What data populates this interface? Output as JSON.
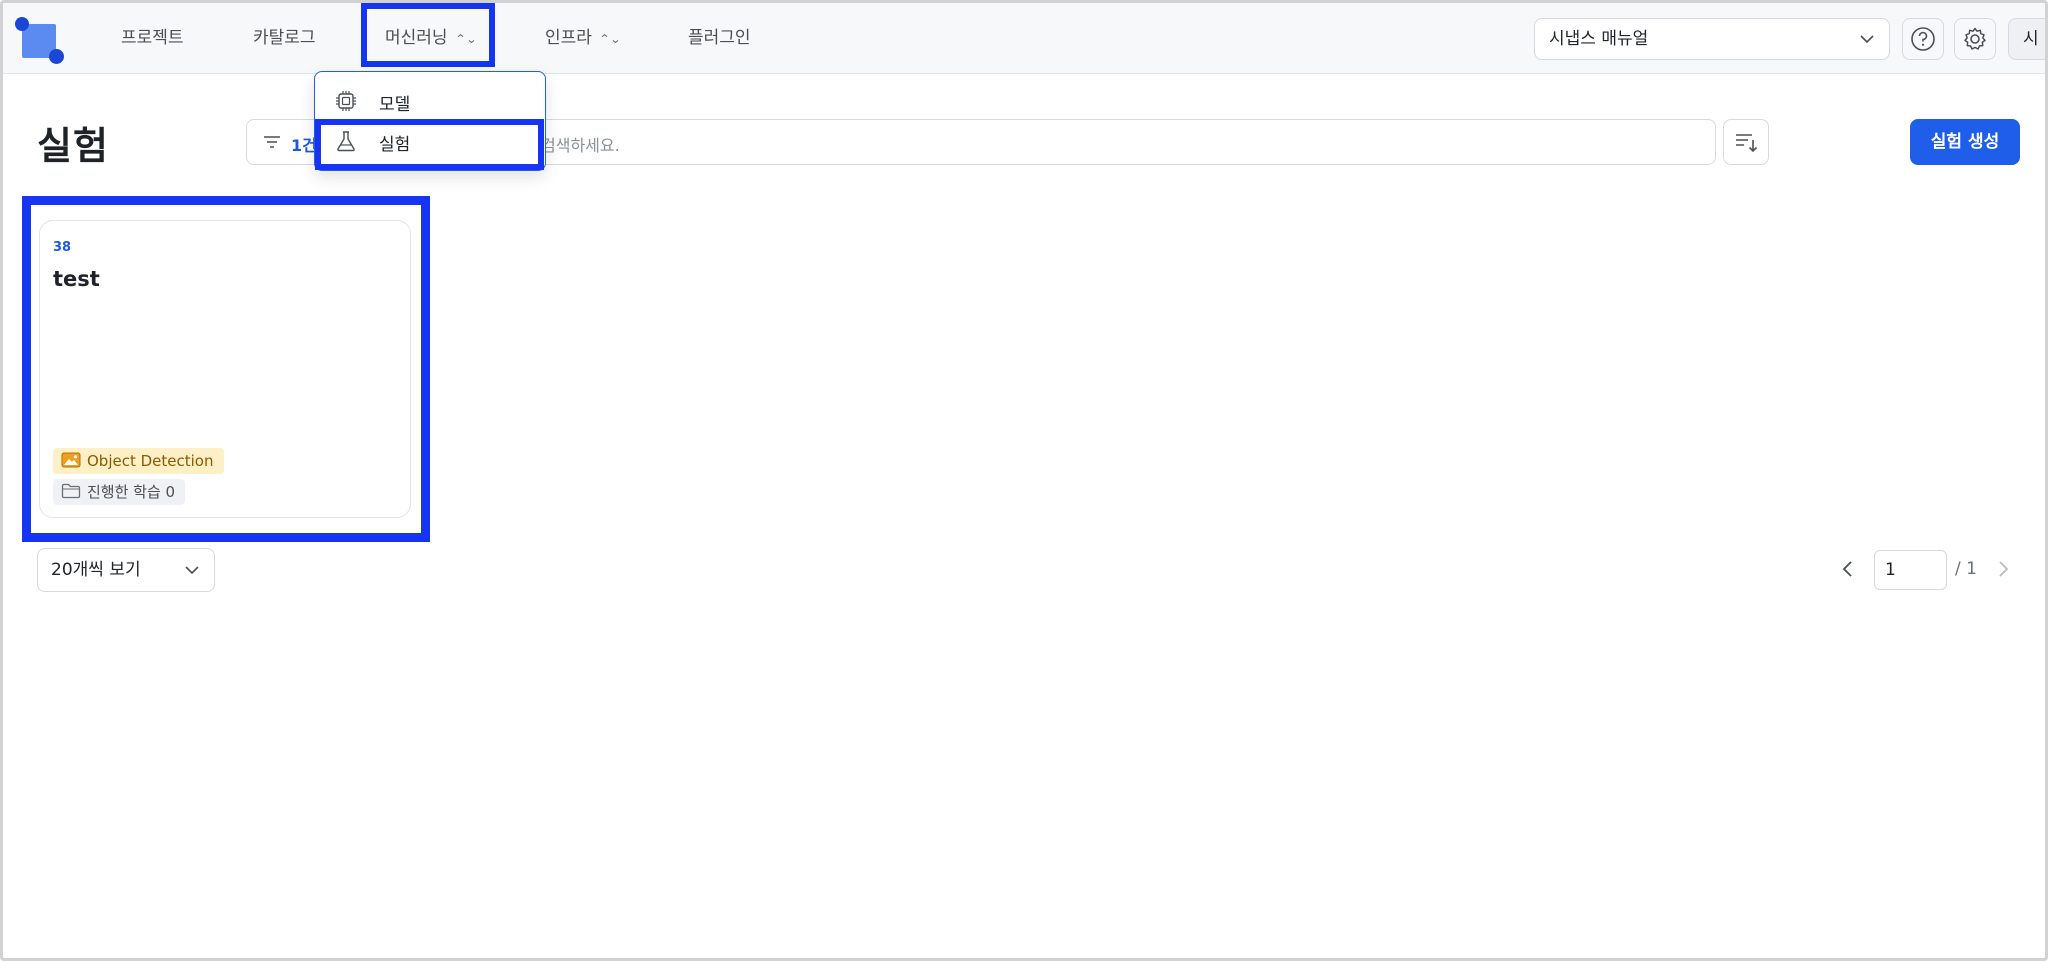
{
  "nav": {
    "items": [
      {
        "label": "프로젝트"
      },
      {
        "label": "카탈로그"
      },
      {
        "label": "머신러닝"
      },
      {
        "label": "인프라"
      },
      {
        "label": "플러그인"
      }
    ],
    "doc_select": "시냅스 매뉴얼",
    "avatar": "시"
  },
  "dropdown": {
    "items": [
      {
        "label": "모델",
        "icon": "chip-icon"
      },
      {
        "label": "실험",
        "icon": "flask-icon"
      }
    ]
  },
  "page": {
    "title": "실험",
    "search": {
      "count": "1건",
      "placeholder": "검색하세요."
    },
    "create_button": "실험 생성"
  },
  "card": {
    "id": "38",
    "name": "test",
    "tag_type": "Object Detection",
    "tag_training": "진행한 학습 0"
  },
  "footer": {
    "per_page": "20개씩 보기",
    "page_current": "1",
    "page_total": "/ 1"
  },
  "colors": {
    "accent": "#1f5ee8",
    "highlight": "#1535f0",
    "tag_yellow_bg": "#fdf0c6"
  }
}
